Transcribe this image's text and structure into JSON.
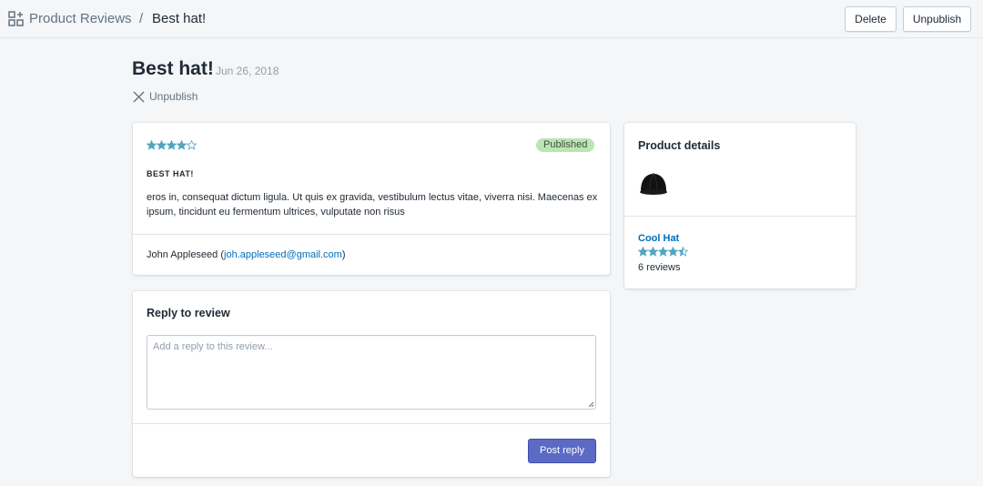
{
  "topbar": {
    "app_name": "Product Reviews",
    "separator": "/",
    "current": "Best hat!",
    "delete_label": "Delete",
    "unpublish_label": "Unpublish"
  },
  "header": {
    "title": "Best hat!",
    "date": "Jun 26, 2018",
    "unpublish_action": "Unpublish"
  },
  "review": {
    "rating": 4,
    "max_rating": 5,
    "status": "Published",
    "title": "BEST HAT!",
    "body": "eros in, consequat dictum ligula. Ut quis ex gravida, vestibulum lectus vitae, viverra nisi. Maecenas ex ipsum, tincidunt eu fermentum ultrices, vulputate non risus",
    "author_name": "John Appleseed",
    "author_email": "joh.appleseed@gmail.com"
  },
  "reply": {
    "heading": "Reply to review",
    "placeholder": "Add a reply to this review...",
    "value": "",
    "submit_label": "Post reply"
  },
  "product": {
    "heading": "Product details",
    "name": "Cool Hat",
    "rating": 4.5,
    "reviews_count": "6 reviews"
  },
  "colors": {
    "accent": "#5c6ac4",
    "link": "#006fbb",
    "star": "#50a5bf",
    "badge_bg": "#bbe5b3"
  },
  "icons": [
    "apps-icon",
    "close-icon",
    "star-icon",
    "hat-image"
  ]
}
